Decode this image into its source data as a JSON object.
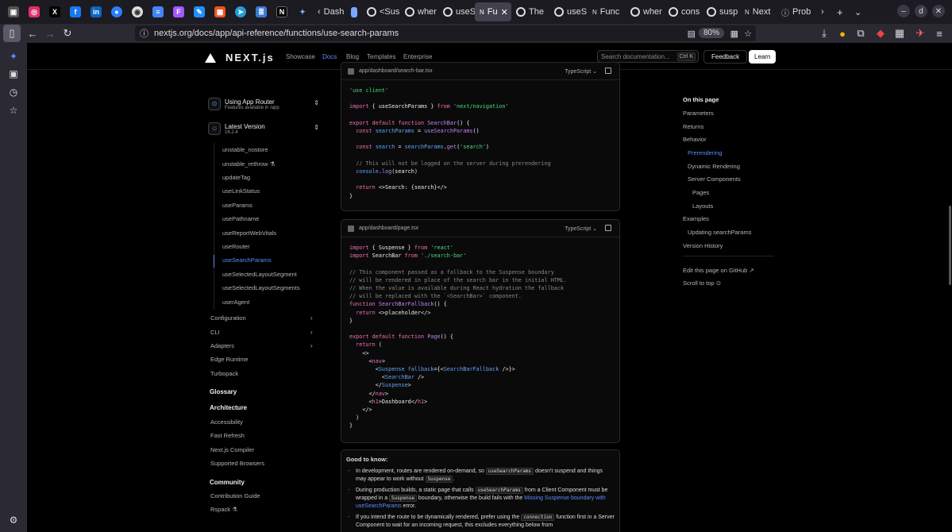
{
  "browser": {
    "tabs": [
      {
        "label": "Dash",
        "active": false
      },
      {
        "label": "<Sus",
        "active": false
      },
      {
        "label": "wher",
        "active": false
      },
      {
        "label": "useS",
        "active": false
      },
      {
        "label": "Fu",
        "active": true
      },
      {
        "label": "The",
        "active": false
      },
      {
        "label": "useS",
        "active": false
      },
      {
        "label": "Func",
        "active": false
      },
      {
        "label": "wher",
        "active": false
      },
      {
        "label": "cons",
        "active": false
      },
      {
        "label": "susp",
        "active": false
      },
      {
        "label": "Next",
        "active": false
      },
      {
        "label": "Prob",
        "active": false
      }
    ],
    "url": "nextjs.org/docs/app/api-reference/functions/use-search-params",
    "zoom": "80%",
    "pinned_icons": [
      "instagram-icon",
      "x-icon",
      "facebook-icon",
      "linkedin-icon",
      "messenger-icon",
      "chrome-icon",
      "doc-icon",
      "figma-icon",
      "microsoft-icon",
      "telegram-icon",
      "notes-icon",
      "next-icon",
      "ai-icon"
    ]
  },
  "site": {
    "logo_text": "NEXT.js",
    "nav": [
      "Showcase",
      "Docs",
      "Blog",
      "Templates",
      "Enterprise"
    ],
    "search_placeholder": "Search documentation...",
    "search_kbd": "Ctrl K",
    "feedback": "Feedback",
    "learn": "Learn"
  },
  "sidebar": {
    "router_title": "Using App Router",
    "router_sub": "Features available in /app",
    "version_title": "Latest Version",
    "version_sub": "16.2.4",
    "items": [
      {
        "label": "unstable_rethrow",
        "kind": "sub"
      },
      {
        "label": "updateTag",
        "kind": "sub"
      },
      {
        "label": "useLinkStatus",
        "kind": "sub"
      },
      {
        "label": "useParams",
        "kind": "sub"
      },
      {
        "label": "usePathname",
        "kind": "sub"
      },
      {
        "label": "useReportWebVitals",
        "kind": "sub"
      },
      {
        "label": "useRouter",
        "kind": "sub"
      },
      {
        "label": "useSearchParams",
        "kind": "sub"
      },
      {
        "label": "useSelectedLayoutSegment",
        "kind": "sub"
      },
      {
        "label": "useSelectedLayoutSegments",
        "kind": "sub"
      },
      {
        "label": "userAgent",
        "kind": "sub"
      },
      {
        "label": "Configuration",
        "kind": "top"
      },
      {
        "label": "CLI",
        "kind": "top"
      },
      {
        "label": "Adapters",
        "kind": "top"
      },
      {
        "label": "Edge Runtime",
        "kind": "top"
      },
      {
        "label": "Turbopack",
        "kind": "top"
      },
      {
        "label": "Glossary",
        "kind": "head"
      },
      {
        "label": "Architecture",
        "kind": "head"
      },
      {
        "label": "Accessibility",
        "kind": "top"
      },
      {
        "label": "Fast Refresh",
        "kind": "top"
      },
      {
        "label": "Next.js Compiler",
        "kind": "top"
      },
      {
        "label": "Supported Browsers",
        "kind": "top"
      },
      {
        "label": "Community",
        "kind": "head"
      },
      {
        "label": "Contribution Guide",
        "kind": "top"
      },
      {
        "label": "Rspack",
        "kind": "top"
      }
    ],
    "partial_top_item": "unstable_nostore"
  },
  "code1": {
    "file": "app/dashboard/search-bar.tsx",
    "lang": "TypeScript"
  },
  "code2": {
    "file": "app/dashboard/page.tsx",
    "lang": "TypeScript"
  },
  "good_to_know": {
    "title": "Good to know:",
    "b1_a": "In development, routes are rendered on-demand, so",
    "b1_code": "useSearchParams",
    "b1_b": "doesn't suspend and things may appear to work without",
    "b1_code2": "Suspense",
    "b1_c": ".",
    "b2_a": "During production builds, a static page that calls",
    "b2_code": "useSearchParams",
    "b2_b": "from a Client Component must be wrapped in a",
    "b2_code2": "Suspense",
    "b2_c": "boundary, otherwise the build fails with the",
    "b2_link": "Missing Suspense boundary with useSearchParams",
    "b2_d": "error.",
    "b3_a": "If you intend the route to be dynamically rendered, prefer using the",
    "b3_code": "connection",
    "b3_b": "function first in a Server Component to wait for an incoming request, this excludes everything below from"
  },
  "toc": {
    "title": "On this page",
    "items": [
      {
        "label": "Parameters",
        "level": 0
      },
      {
        "label": "Returns",
        "level": 0
      },
      {
        "label": "Behavior",
        "level": 0
      },
      {
        "label": "Prerendering",
        "level": 1,
        "active": true
      },
      {
        "label": "Dynamic Rendering",
        "level": 1
      },
      {
        "label": "Server Components",
        "level": 1
      },
      {
        "label": "Pages",
        "level": 2
      },
      {
        "label": "Layouts",
        "level": 2
      },
      {
        "label": "Examples",
        "level": 0
      },
      {
        "label": "Updating searchParams",
        "level": 1
      },
      {
        "label": "Version History",
        "level": 0
      }
    ],
    "edit": "Edit this page on GitHub",
    "scroll": "Scroll to top"
  }
}
